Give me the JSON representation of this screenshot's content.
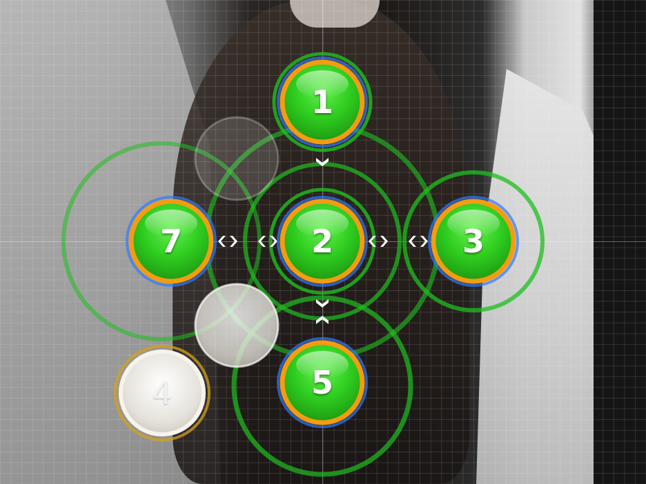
{
  "game": {
    "notes": [
      {
        "id": "note-1",
        "label": "1",
        "state": "active"
      },
      {
        "id": "note-2",
        "label": "2",
        "state": "active"
      },
      {
        "id": "note-3",
        "label": "3",
        "state": "active"
      },
      {
        "id": "note-5",
        "label": "5",
        "state": "active"
      },
      {
        "id": "note-7",
        "label": "7",
        "state": "active"
      },
      {
        "id": "note-4",
        "label": "4",
        "state": "faded"
      }
    ],
    "colors": {
      "note_fill": "#2ecc1f",
      "note_ring": "#f39c12",
      "note_glow": "#2f7bff",
      "approach_ring": "#1fbf1f",
      "faded_fill": "#e6e4dc",
      "faded_ring": "#d4a21a",
      "connector_arrow": "#ffffff"
    }
  }
}
